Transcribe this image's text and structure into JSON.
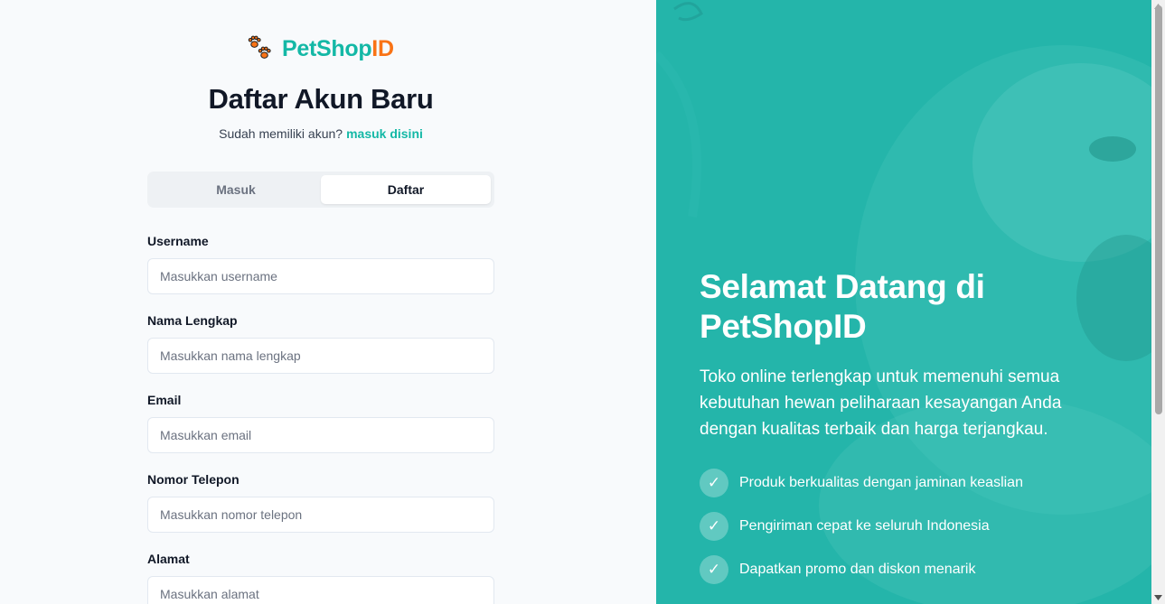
{
  "brand": {
    "name_part1": "PetShop",
    "name_part2": "ID",
    "accent": "#14b8a6",
    "orange": "#f97316"
  },
  "form": {
    "title": "Daftar Akun Baru",
    "subtitle_text": "Sudah memiliki akun?",
    "subtitle_link": "masuk disini",
    "tabs": [
      {
        "label": "Masuk",
        "active": false
      },
      {
        "label": "Daftar",
        "active": true
      }
    ],
    "fields": [
      {
        "label": "Username",
        "placeholder": "Masukkan username"
      },
      {
        "label": "Nama Lengkap",
        "placeholder": "Masukkan nama lengkap"
      },
      {
        "label": "Email",
        "placeholder": "Masukkan email"
      },
      {
        "label": "Nomor Telepon",
        "placeholder": "Masukkan nomor telepon"
      },
      {
        "label": "Alamat",
        "placeholder": "Masukkan alamat"
      }
    ]
  },
  "hero": {
    "title": "Selamat Datang di PetShopID",
    "description": "Toko online terlengkap untuk memenuhi semua kebutuhan hewan peliharaan kesayangan Anda dengan kualitas terbaik dan harga terjangkau.",
    "features": [
      {
        "icon": "check-icon",
        "text": "Produk berkualitas dengan jaminan keaslian"
      },
      {
        "icon": "check-icon",
        "text": "Pengiriman cepat ke seluruh Indonesia"
      },
      {
        "icon": "check-icon",
        "text": "Dapatkan promo dan diskon menarik"
      }
    ],
    "background": "#24b5aa"
  }
}
